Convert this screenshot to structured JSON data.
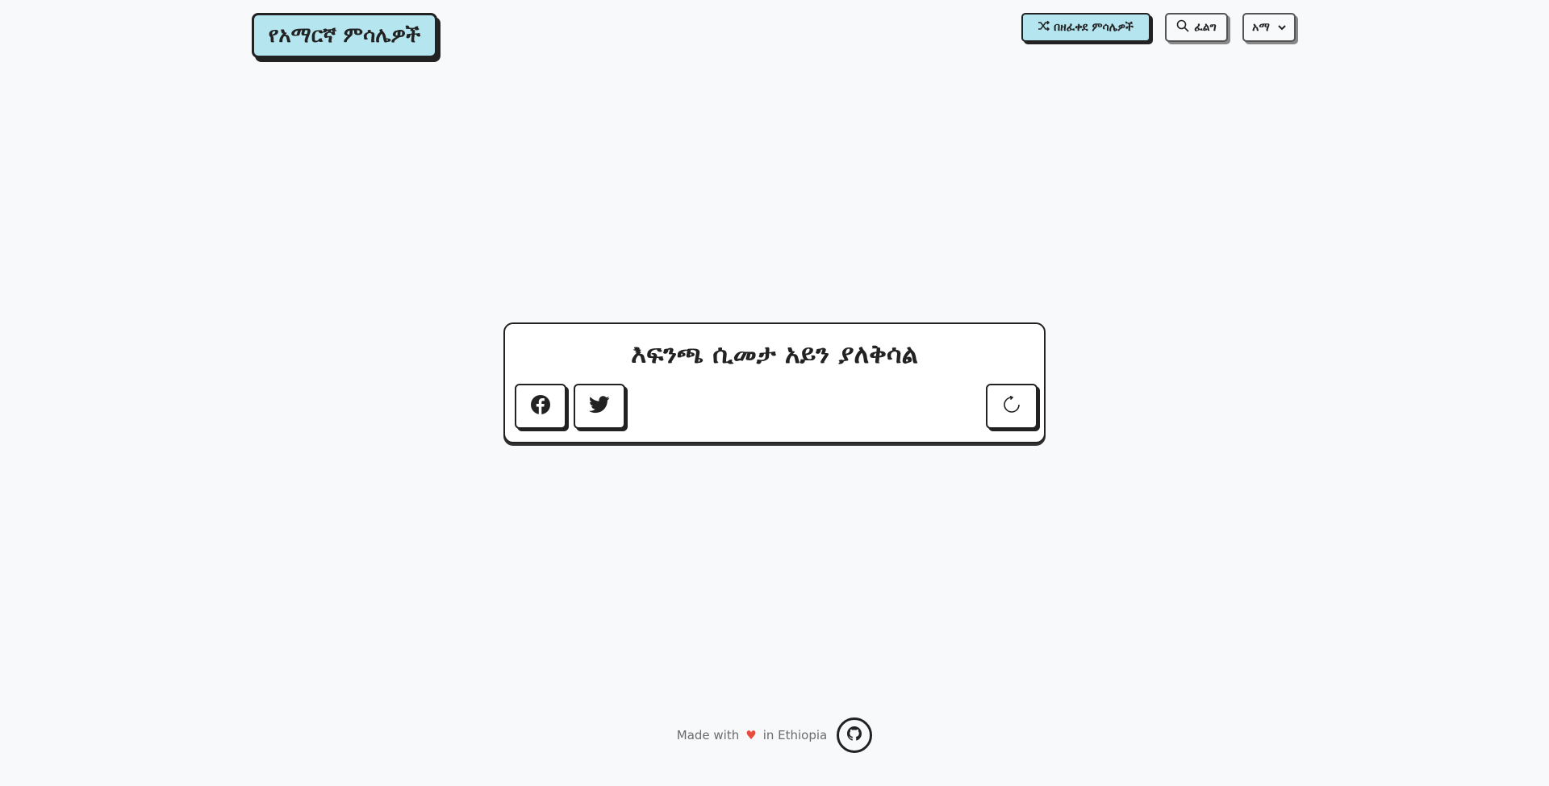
{
  "header": {
    "logo_text": "የአማርኛ ምሳሌዎች",
    "random_label": "በዘፈቀደ ምሳሌዎች",
    "search_label": "ፈልግ",
    "language_selected": "አማ"
  },
  "card": {
    "proverb_text": "እፍንጫ ሲመታ አይን ያለቅሳል"
  },
  "footer": {
    "made_with": "Made with",
    "heart": "♥",
    "in_country": "in Ethiopia"
  },
  "colors": {
    "accent": "#b5e6f0",
    "border": "#222222",
    "background": "#f8f9fb",
    "heart": "#e74c3c"
  },
  "icons": {
    "random": "shuffle-icon",
    "search": "search-icon",
    "language": "chevron-down-icon",
    "facebook": "facebook-icon",
    "twitter": "twitter-icon",
    "refresh": "refresh-icon",
    "github": "github-icon"
  }
}
